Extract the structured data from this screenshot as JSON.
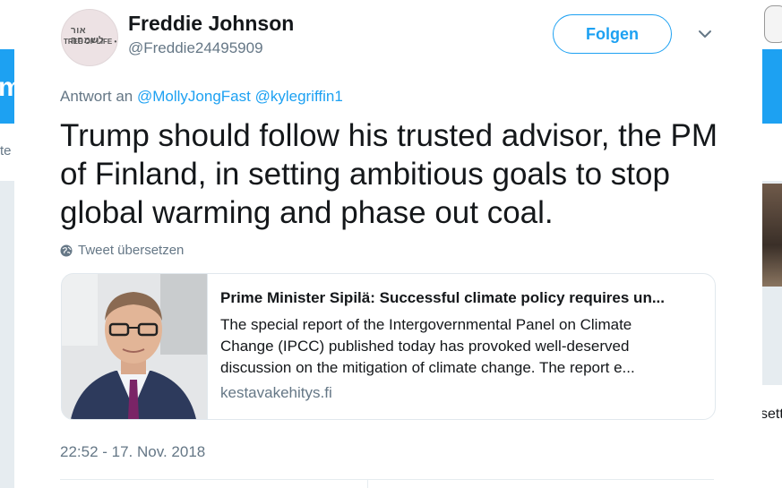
{
  "background": {
    "left_fragment_blue": "m",
    "left_fragment_white": "te",
    "right_fragment_text": "sett"
  },
  "tweet": {
    "display_name": "Freddie Johnson",
    "handle": "@Freddie24495909",
    "avatar_text_line1": "אור לשמחה",
    "avatar_text_line2": "TREE OF LIFE •",
    "follow_label": "Folgen",
    "reply_prefix": "Antwort an",
    "reply_mentions": "@MollyJongFast @kylegriffin1",
    "text": "Trump should follow his trusted advisor, the PM of Finland, in setting ambitious goals to stop global warming and phase out coal.",
    "translate_label": "Tweet übersetzen",
    "timestamp": "22:52 - 17. Nov. 2018"
  },
  "card": {
    "title": "Prime Minister Sipilä: Successful climate policy requires un...",
    "description": "The special report of the Intergovernmental Panel on Climate Change (IPCC) published today has provoked well-deserved discussion on the mitigation of climate change. The report e...",
    "domain": "kestavakehitys.fi"
  },
  "colors": {
    "accent": "#1da1f2",
    "text": "#14171a",
    "secondary": "#657786"
  },
  "icons": {
    "menu": "chevron-down-icon",
    "translate": "globe-icon"
  }
}
